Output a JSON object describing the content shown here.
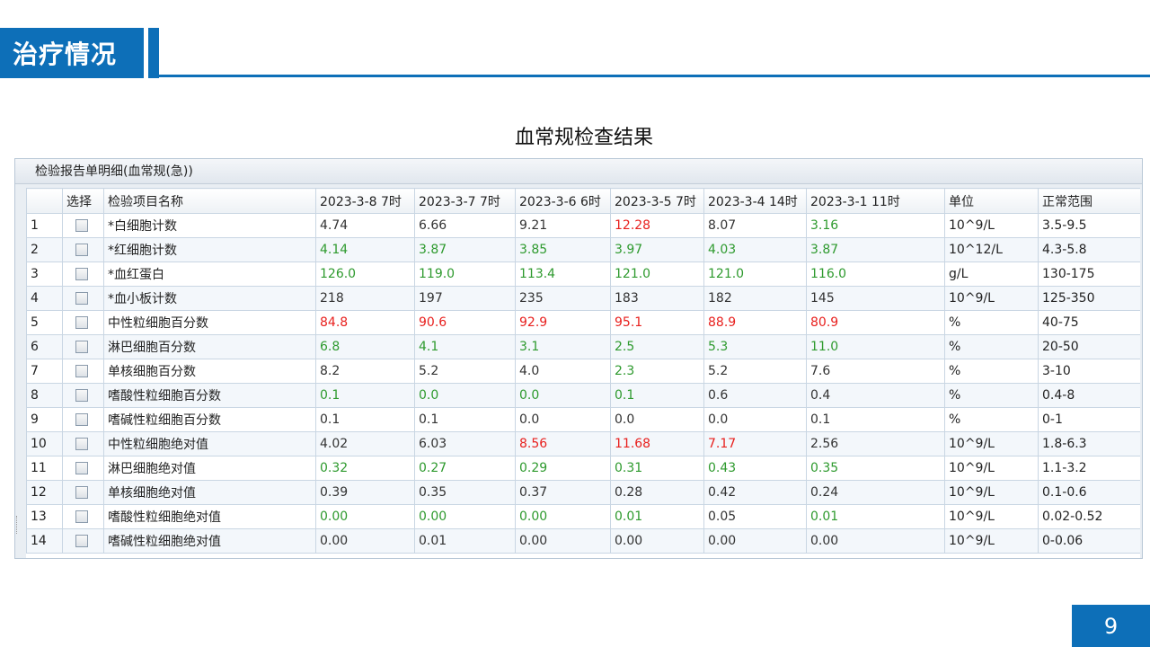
{
  "header": {
    "title": "治疗情况"
  },
  "subtitle": "血常规检查结果",
  "panel": {
    "title": "检验报告单明细(血常规(急))",
    "columns": [
      "",
      "选择",
      "检验项目名称",
      "2023-3-8 7时",
      "2023-3-7 7时",
      "2023-3-6 6时",
      "2023-3-5 7时",
      "2023-3-4 14时",
      "2023-3-1 11时",
      "单位",
      "正常范围"
    ],
    "rows": [
      {
        "no": "1",
        "name": "*白细胞计数",
        "values": [
          "4.74",
          "6.66",
          "9.21",
          "12.28",
          "8.07",
          "3.16"
        ],
        "status": [
          "n",
          "n",
          "n",
          "h",
          "n",
          "l"
        ],
        "unit": "10^9/L",
        "range": "3.5-9.5"
      },
      {
        "no": "2",
        "name": "*红细胞计数",
        "values": [
          "4.14",
          "3.87",
          "3.85",
          "3.97",
          "4.03",
          "3.87"
        ],
        "status": [
          "l",
          "l",
          "l",
          "l",
          "l",
          "l"
        ],
        "unit": "10^12/L",
        "range": "4.3-5.8"
      },
      {
        "no": "3",
        "name": "*血红蛋白",
        "values": [
          "126.0",
          "119.0",
          "113.4",
          "121.0",
          "121.0",
          "116.0"
        ],
        "status": [
          "l",
          "l",
          "l",
          "l",
          "l",
          "l"
        ],
        "unit": "g/L",
        "range": "130-175"
      },
      {
        "no": "4",
        "name": "*血小板计数",
        "values": [
          "218",
          "197",
          "235",
          "183",
          "182",
          "145"
        ],
        "status": [
          "n",
          "n",
          "n",
          "n",
          "n",
          "n"
        ],
        "unit": "10^9/L",
        "range": "125-350"
      },
      {
        "no": "5",
        "name": "中性粒细胞百分数",
        "values": [
          "84.8",
          "90.6",
          "92.9",
          "95.1",
          "88.9",
          "80.9"
        ],
        "status": [
          "h",
          "h",
          "h",
          "h",
          "h",
          "h"
        ],
        "unit": "%",
        "range": "40-75"
      },
      {
        "no": "6",
        "name": "淋巴细胞百分数",
        "values": [
          "6.8",
          "4.1",
          "3.1",
          "2.5",
          "5.3",
          "11.0"
        ],
        "status": [
          "l",
          "l",
          "l",
          "l",
          "l",
          "l"
        ],
        "unit": "%",
        "range": "20-50"
      },
      {
        "no": "7",
        "name": "单核细胞百分数",
        "values": [
          "8.2",
          "5.2",
          "4.0",
          "2.3",
          "5.2",
          "7.6"
        ],
        "status": [
          "n",
          "n",
          "n",
          "l",
          "n",
          "n"
        ],
        "unit": "%",
        "range": "3-10"
      },
      {
        "no": "8",
        "name": "嗜酸性粒细胞百分数",
        "values": [
          "0.1",
          "0.0",
          "0.0",
          "0.1",
          "0.6",
          "0.4"
        ],
        "status": [
          "l",
          "l",
          "l",
          "l",
          "n",
          "n"
        ],
        "unit": "%",
        "range": "0.4-8"
      },
      {
        "no": "9",
        "name": "嗜碱性粒细胞百分数",
        "values": [
          "0.1",
          "0.1",
          "0.0",
          "0.0",
          "0.0",
          "0.1"
        ],
        "status": [
          "n",
          "n",
          "n",
          "n",
          "n",
          "n"
        ],
        "unit": "%",
        "range": "0-1"
      },
      {
        "no": "10",
        "name": "中性粒细胞绝对值",
        "values": [
          "4.02",
          "6.03",
          "8.56",
          "11.68",
          "7.17",
          "2.56"
        ],
        "status": [
          "n",
          "n",
          "h",
          "h",
          "h",
          "n"
        ],
        "unit": "10^9/L",
        "range": "1.8-6.3"
      },
      {
        "no": "11",
        "name": "淋巴细胞绝对值",
        "values": [
          "0.32",
          "0.27",
          "0.29",
          "0.31",
          "0.43",
          "0.35"
        ],
        "status": [
          "l",
          "l",
          "l",
          "l",
          "l",
          "l"
        ],
        "unit": "10^9/L",
        "range": "1.1-3.2"
      },
      {
        "no": "12",
        "name": "单核细胞绝对值",
        "values": [
          "0.39",
          "0.35",
          "0.37",
          "0.28",
          "0.42",
          "0.24"
        ],
        "status": [
          "n",
          "n",
          "n",
          "n",
          "n",
          "n"
        ],
        "unit": "10^9/L",
        "range": "0.1-0.6"
      },
      {
        "no": "13",
        "name": "嗜酸性粒细胞绝对值",
        "values": [
          "0.00",
          "0.00",
          "0.00",
          "0.01",
          "0.05",
          "0.01"
        ],
        "status": [
          "l",
          "l",
          "l",
          "l",
          "n",
          "l"
        ],
        "unit": "10^9/L",
        "range": "0.02-0.52"
      },
      {
        "no": "14",
        "name": "嗜碱性粒细胞绝对值",
        "values": [
          "0.00",
          "0.01",
          "0.00",
          "0.00",
          "0.00",
          "0.00"
        ],
        "status": [
          "n",
          "n",
          "n",
          "n",
          "n",
          "n"
        ],
        "unit": "10^9/L",
        "range": "0-0.06"
      }
    ]
  },
  "colors": {
    "accent": "#0d6fb8",
    "high": "#e8201e",
    "low": "#2e9a2e",
    "normal": "#333333"
  },
  "page_number": "9"
}
